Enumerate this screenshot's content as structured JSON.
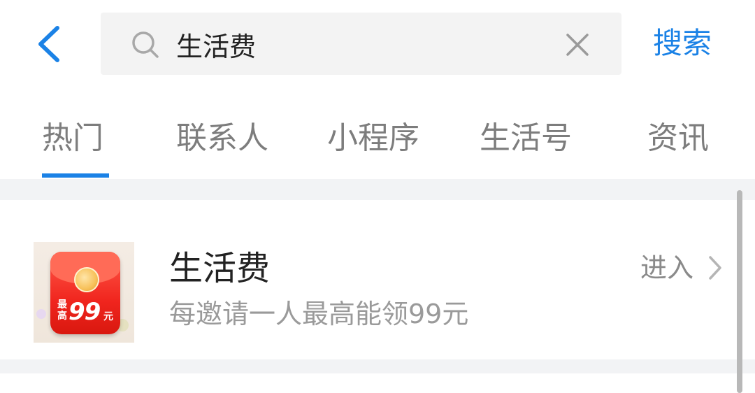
{
  "header": {
    "search": {
      "value": "生活费"
    },
    "search_button_label": "搜索"
  },
  "tabs": [
    {
      "label": "热门",
      "active": true
    },
    {
      "label": "联系人",
      "active": false
    },
    {
      "label": "小程序",
      "active": false
    },
    {
      "label": "生活号",
      "active": false
    },
    {
      "label": "资讯",
      "active": false
    }
  ],
  "results": [
    {
      "title": "生活费",
      "description": "每邀请一人最高能领99元",
      "action_label": "进入",
      "thumbnail": {
        "badge_small": "最高",
        "amount": "99",
        "unit": "元"
      }
    }
  ],
  "colors": {
    "accent": "#1b82e6",
    "active_tab_text": "#7d7d7d",
    "inactive_tab_text": "#7d7d7d",
    "divider_background": "#f2f3f5",
    "envelope_red": "#f0251e"
  },
  "icons": {
    "back": "chevron-left-icon",
    "search": "search-icon",
    "clear": "close-icon",
    "enter": "chevron-right-icon"
  }
}
